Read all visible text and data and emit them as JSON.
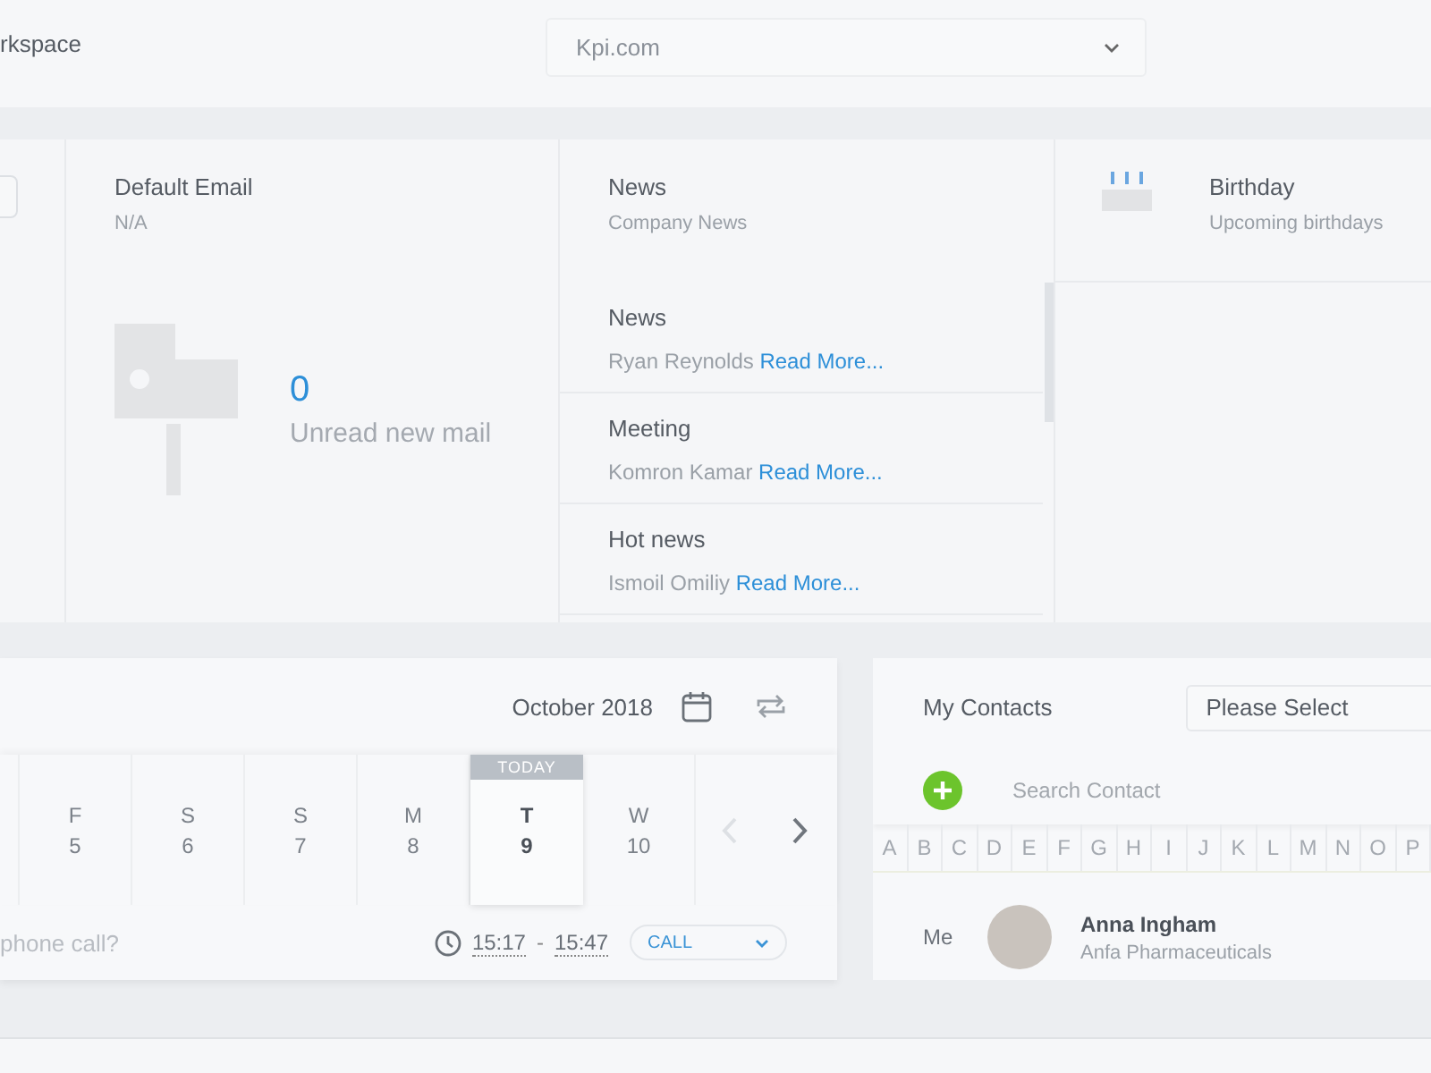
{
  "workspace": {
    "label": "rkspace",
    "domain": "Kpi.com"
  },
  "email": {
    "title": "Default Email",
    "value": "N/A",
    "unread_count": "0",
    "unread_label": "Unread new mail"
  },
  "news": {
    "title": "News",
    "subtitle": "Company News",
    "items": [
      {
        "title": "News",
        "author": "Ryan Reynolds",
        "link": "Read More..."
      },
      {
        "title": "Meeting",
        "author": "Komron Kamar",
        "link": "Read More..."
      },
      {
        "title": "Hot news",
        "author": "Ismoil Omiliy",
        "link": "Read More..."
      }
    ]
  },
  "birthday": {
    "title": "Birthday",
    "subtitle": "Upcoming birthdays"
  },
  "calendar": {
    "month": "October 2018",
    "today_label": "TODAY",
    "days": [
      {
        "weekday": "F",
        "day": "5",
        "selected": false
      },
      {
        "weekday": "S",
        "day": "6",
        "selected": false
      },
      {
        "weekday": "S",
        "day": "7",
        "selected": false
      },
      {
        "weekday": "M",
        "day": "8",
        "selected": false
      },
      {
        "weekday": "T",
        "day": "9",
        "selected": true
      },
      {
        "weekday": "W",
        "day": "10",
        "selected": false
      }
    ],
    "event": {
      "placeholder": "phone call?",
      "start": "15:17",
      "separator": "-",
      "end": "15:47",
      "type": "CALL"
    }
  },
  "contacts": {
    "title": "My Contacts",
    "filter": "Please Select",
    "search_placeholder": "Search Contact",
    "letters": [
      "A",
      "B",
      "C",
      "D",
      "E",
      "F",
      "G",
      "H",
      "I",
      "J",
      "K",
      "L",
      "M",
      "N",
      "O",
      "P"
    ],
    "rows": [
      {
        "label": "Me",
        "name": "Anna Ingham",
        "company": "Anfa Pharmaceuticals"
      }
    ]
  }
}
